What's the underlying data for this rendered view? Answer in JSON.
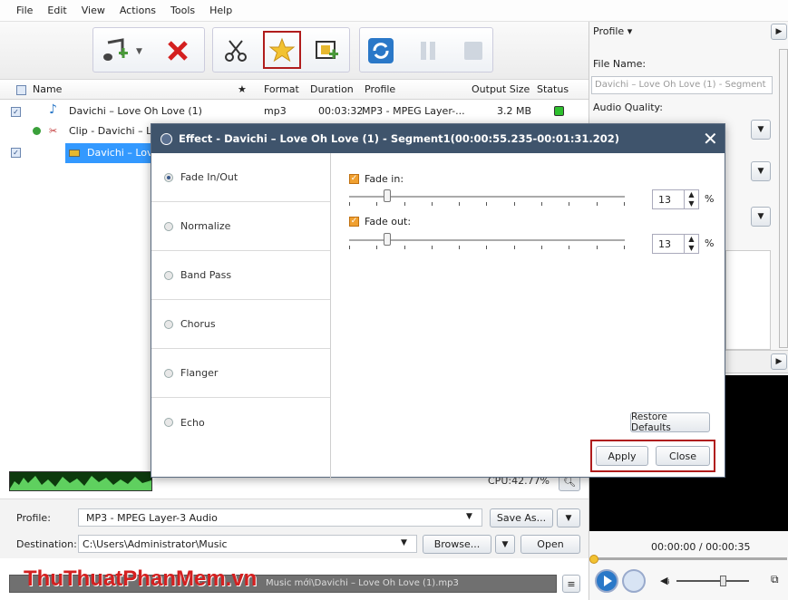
{
  "menu": [
    "File",
    "Edit",
    "View",
    "Actions",
    "Tools",
    "Help"
  ],
  "columns": {
    "name": "Name",
    "star": "★",
    "format": "Format",
    "duration": "Duration",
    "profile": "Profile",
    "size": "Output Size",
    "status": "Status"
  },
  "files": [
    {
      "name": "Davichi – Love Oh Love (1)",
      "format": "mp3",
      "duration": "00:03:32",
      "profile": "MP3 - MPEG Layer-...",
      "size": "3.2 MB"
    },
    {
      "name": "Clip - Davichi – L"
    },
    {
      "name": "Davichi – Lov"
    }
  ],
  "side": {
    "profile_btn": "Profile ▾",
    "file_name_label": "File Name:",
    "file_name_value": "Davichi – Love Oh Love (1) - Segment",
    "audio_quality_label": "Audio Quality:",
    "time": "00:00:00 / 00:00:35"
  },
  "bottom": {
    "cpu": "CPU:42.77%",
    "profile_label": "Profile:",
    "profile_value": "MP3 - MPEG Layer-3 Audio",
    "save_as": "Save As...",
    "dest_label": "Destination:",
    "dest_value": "C:\\Users\\Administrator\\Music",
    "browse": "Browse...",
    "open": "Open",
    "status_path": "Music mới\\Davichi – Love Oh Love (1).mp3",
    "watermark": "ThuThuatPhanMem.vn"
  },
  "dialog": {
    "title": "Effect - Davichi – Love Oh Love (1) - Segment1(00:00:55.235-00:01:31.202)",
    "effects": [
      "Fade In/Out",
      "Normalize",
      "Band Pass",
      "Chorus",
      "Flanger",
      "Echo"
    ],
    "fade_in_label": "Fade in:",
    "fade_in_value": "13",
    "fade_out_label": "Fade out:",
    "fade_out_value": "13",
    "percent": "%",
    "restore": "Restore Defaults",
    "apply": "Apply",
    "close": "Close"
  }
}
